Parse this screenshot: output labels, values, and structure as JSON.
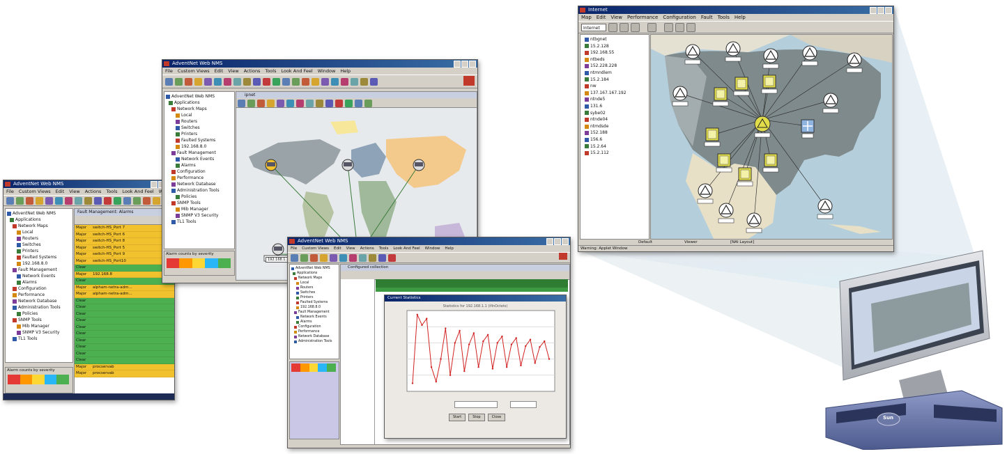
{
  "win_left": {
    "title": "AdventNet Web NMS",
    "menu": [
      "File",
      "Custom Views",
      "Edit",
      "View",
      "Actions",
      "Tools",
      "Look And Feel",
      "Window",
      "Help"
    ],
    "tree_items": [
      "AdventNet Web NMS",
      "Applications",
      "Network Maps",
      "Local",
      "Routers",
      "Switches",
      "Printers",
      "Faulted Systems",
      "192.168.8.0",
      "Fault Management",
      "Network Events",
      "Alarms",
      "Configuration",
      "Performance",
      "Network Database",
      "Administration Tools",
      "Policies",
      "SNMP Tools",
      "Mib Manager",
      "SNMP V3 Security",
      "TL1 Tools"
    ],
    "panel_title": "Fault Management: Alarms",
    "rows": [
      {
        "sev": "Major",
        "src": "switch-HS_Port 7",
        "color": "#f2c12e"
      },
      {
        "sev": "Major",
        "src": "switch-HS_Port 6",
        "color": "#f2c12e"
      },
      {
        "sev": "Major",
        "src": "switch-HS_Port 8",
        "color": "#f2c12e"
      },
      {
        "sev": "Major",
        "src": "switch-HS_Port 5",
        "color": "#f2c12e"
      },
      {
        "sev": "Major",
        "src": "switch-HS_Port 9",
        "color": "#f2c12e"
      },
      {
        "sev": "Major",
        "src": "switch-HS_Port10",
        "color": "#f2c12e"
      },
      {
        "sev": "Clear",
        "src": "",
        "color": "#4caf50"
      },
      {
        "sev": "Major",
        "src": "192.168.8",
        "color": "#f2c12e"
      },
      {
        "sev": "Clear",
        "src": "",
        "color": "#4caf50"
      },
      {
        "sev": "Major",
        "src": "alpham-netra-adm...",
        "color": "#f2c12e"
      },
      {
        "sev": "Major",
        "src": "alpham-netra-adm...",
        "color": "#f2c12e"
      },
      {
        "sev": "Clear",
        "src": "",
        "color": "#4caf50"
      },
      {
        "sev": "Clear",
        "src": "",
        "color": "#4caf50"
      },
      {
        "sev": "Clear",
        "src": "",
        "color": "#4caf50"
      },
      {
        "sev": "Clear",
        "src": "",
        "color": "#4caf50"
      },
      {
        "sev": "Clear",
        "src": "",
        "color": "#4caf50"
      },
      {
        "sev": "Clear",
        "src": "",
        "color": "#4caf50"
      },
      {
        "sev": "Clear",
        "src": "",
        "color": "#4caf50"
      },
      {
        "sev": "Clear",
        "src": "",
        "color": "#4caf50"
      },
      {
        "sev": "Clear",
        "src": "",
        "color": "#4caf50"
      },
      {
        "sev": "Clear",
        "src": "",
        "color": "#4caf50"
      },
      {
        "sev": "Major",
        "src": "procservab",
        "color": "#f2c12e"
      },
      {
        "sev": "Major",
        "src": "procservab",
        "color": "#f2c12e"
      }
    ],
    "severity_label": "Alarm counts by severity"
  },
  "win_mid": {
    "title": "AdventNet Web NMS",
    "menu": [
      "File",
      "Custom Views",
      "Edit",
      "View",
      "Actions",
      "Tools",
      "Look And Feel",
      "Window",
      "Help"
    ],
    "panel_title": "ipnet",
    "tree_items": [
      "AdventNet Web NMS",
      "Applications",
      "Network Maps",
      "Local",
      "Routers",
      "Switches",
      "Printers",
      "Faulted Systems",
      "192.168.8.0",
      "Fault Management",
      "Network Events",
      "Alarms",
      "Configuration",
      "Performance",
      "Network Database",
      "Administration Tools",
      "Policies",
      "SNMP Tools",
      "Mib Manager",
      "SNMP V3 Security",
      "TL1 Tools"
    ],
    "severity_label": "Alarm counts by severity",
    "map_node_label": "192.168.1.1"
  },
  "win_front": {
    "title": "AdventNet Web NMS",
    "menu": [
      "File",
      "Custom Views",
      "Edit",
      "View",
      "Actions",
      "Tools",
      "Look And Feel",
      "Window",
      "Help"
    ],
    "panel_title": "Configured collection",
    "graph_title": "Current Statistics",
    "chart_heading": "Statistics for 192.168.1.1 (ifInOctets)",
    "buttons": [
      "Start",
      "Stop",
      "Close"
    ]
  },
  "chart_data": {
    "type": "line",
    "title": "",
    "xlabel": "",
    "ylabel": "",
    "series": [
      {
        "values": [
          10,
          95,
          82,
          90,
          30,
          12,
          40,
          78,
          20,
          60,
          75,
          25,
          58,
          72,
          30,
          62,
          70,
          28,
          60,
          68,
          30,
          58,
          66,
          32,
          56,
          64,
          35,
          55,
          62,
          40
        ]
      }
    ],
    "ylim": [
      0,
      100
    ]
  },
  "win_right": {
    "title": "Internet",
    "menu": [
      "Map",
      "Edit",
      "View",
      "Performance",
      "Configuration",
      "Fault",
      "Tools",
      "Help"
    ],
    "combo": "Internet",
    "root": "Internet",
    "tree_items": [
      "ntbgnet",
      "15.2.128",
      "192.168.55",
      "ntbeds",
      "152.228.228",
      "ntmndlem",
      "15.2.184",
      "nw",
      "137.167.167.192",
      "ntnde5",
      "131.6",
      "sybe02",
      "ntnde04",
      "ntmdsde",
      "152.188",
      "156.6",
      "15.2.64",
      "15.2.112"
    ],
    "status_text": "Warning: Applet Window",
    "status_fields": [
      "Default",
      "Viewer",
      "[NAI Layout]"
    ]
  },
  "monitor": {
    "brand": "Sun"
  },
  "colors": {
    "alarm_major": "#f2c12e",
    "alarm_clear": "#4caf50",
    "titlebar": "#0a246a",
    "chart_line": "#d12020"
  }
}
